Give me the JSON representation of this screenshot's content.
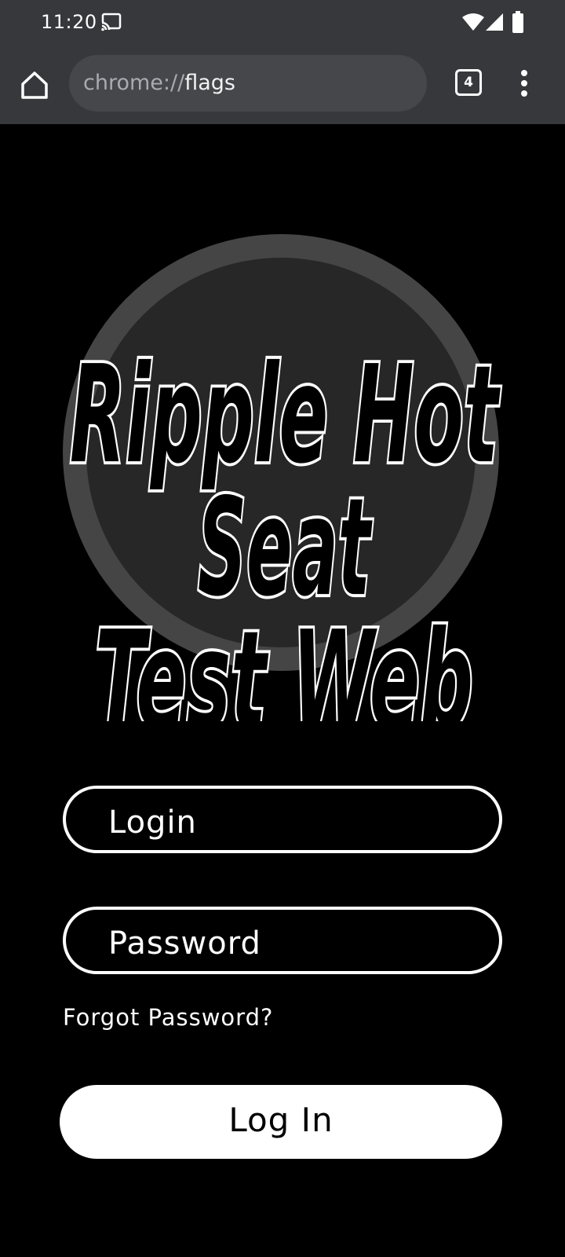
{
  "status_bar": {
    "time": "11:20",
    "icons": [
      "cast-icon",
      "wifi-icon",
      "signal-icon",
      "battery-icon"
    ]
  },
  "browser": {
    "url_scheme": "chrome://",
    "url_host": "flags",
    "tab_count": "4",
    "icons": [
      "home-icon",
      "more-vert-icon"
    ]
  },
  "logo": {
    "lines": [
      "Ripple Hot",
      "Seat",
      "Test Web"
    ]
  },
  "form": {
    "login_placeholder": "Login",
    "password_placeholder": "Password",
    "forgot_link": "Forgot Password?",
    "submit_label": "Log In"
  },
  "colors": {
    "chrome_bar": "#36383c",
    "omnibox": "#45474b",
    "background": "#000000",
    "logo_ring": "#454545",
    "logo_disc": "#272727",
    "accent": "#ffffff"
  }
}
